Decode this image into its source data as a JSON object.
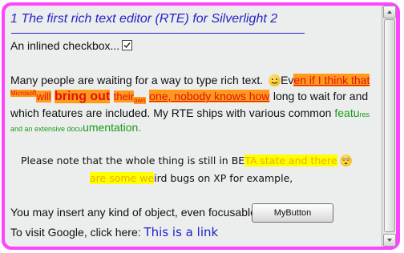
{
  "editor": {
    "title": "1 The first rich text editor (RTE) for Silverlight 2",
    "checkbox_line": "An inlined checkbox...",
    "checkbox_checked": true,
    "para1": {
      "a": "Many people are waiting for a way to type rich text.",
      "b": "Ev",
      "c": "en if I think that",
      "d": "Microsoft",
      "e": "will",
      "f": "bring out",
      "g": "their",
      "h": "own",
      "i": "one, nobody knows how",
      "j": "long to wait for and",
      "k": "which features are included. My RTE ships with various common",
      "l": "featu",
      "m": "res",
      "n": "and an extensive docu",
      "o": "umentation."
    },
    "para2": {
      "a": "Please note that the whole thing is still in BE",
      "b": "TA state and there",
      "c": "are some we",
      "d": "ird bugs on XP for example,"
    },
    "object_line": "You may insert any kind of object, even focusable:",
    "button_label": "MyButton",
    "google_line": "To visit Google, click here:",
    "link_text": "This is a link"
  },
  "icons": {
    "checkbox": "checkmark-icon",
    "emoji1": "smiley-face-icon",
    "emoji2": "worried-face-icon",
    "scroll_up": "arrow-up-icon",
    "scroll_down": "arrow-down-icon"
  },
  "colors": {
    "frame": "#ff44ff",
    "panel": "#eceeed",
    "title": "#2424c8",
    "highlight_orange": "#ff9a1a",
    "highlight_yellow": "#ffff00",
    "text_red": "#e01010",
    "text_green": "#1a9a1a",
    "link": "#2020cc"
  }
}
